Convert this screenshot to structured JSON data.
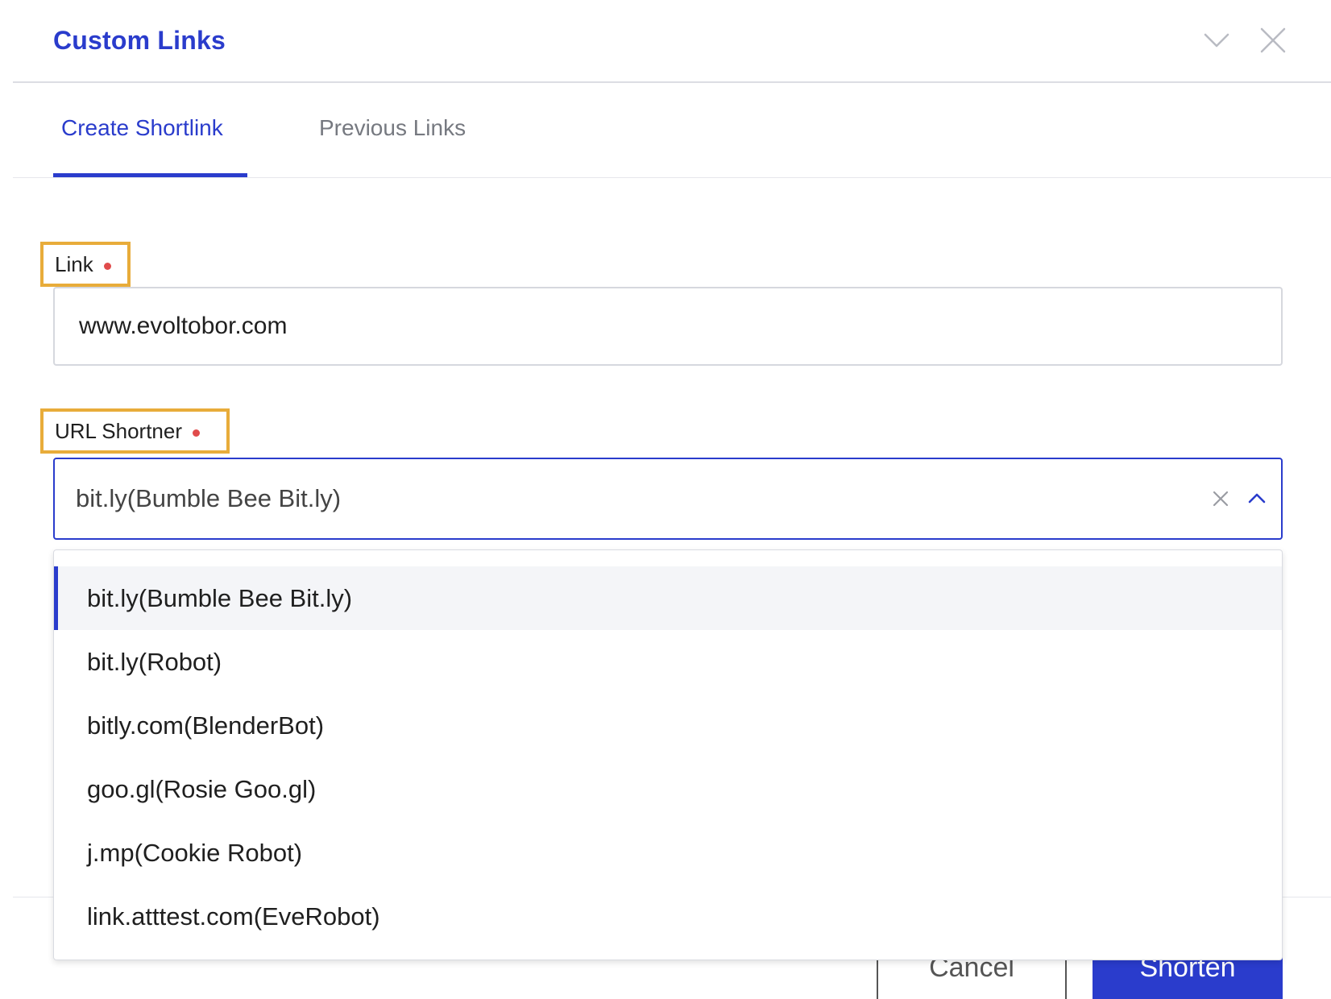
{
  "header": {
    "title": "Custom Links",
    "collapse_icon": "chevron-down-icon",
    "close_icon": "close-icon"
  },
  "tabs": [
    {
      "label": "Create Shortlink",
      "active": true
    },
    {
      "label": "Previous Links",
      "active": false
    }
  ],
  "form": {
    "link": {
      "label": "Link",
      "required": true,
      "value": "www.evoltobor.com"
    },
    "url_shortener": {
      "label": "URL Shortner",
      "required": true,
      "value": "bit.ly(Bumble Bee Bit.ly)",
      "expanded": true,
      "options": [
        "bit.ly(Bumble Bee Bit.ly)",
        "bit.ly(Robot)",
        "bitly.com(BlenderBot)",
        "goo.gl(Rosie Goo.gl)",
        "j.mp(Cookie Robot)",
        "link.atttest.com(EveRobot)"
      ],
      "selected_index": 0
    }
  },
  "footer": {
    "cancel_label": "Cancel",
    "shorten_label": "Shorten"
  },
  "colors": {
    "accent": "#2a3ccc",
    "highlight_border": "#e8ac3a",
    "required_dot": "#e04b4b"
  }
}
